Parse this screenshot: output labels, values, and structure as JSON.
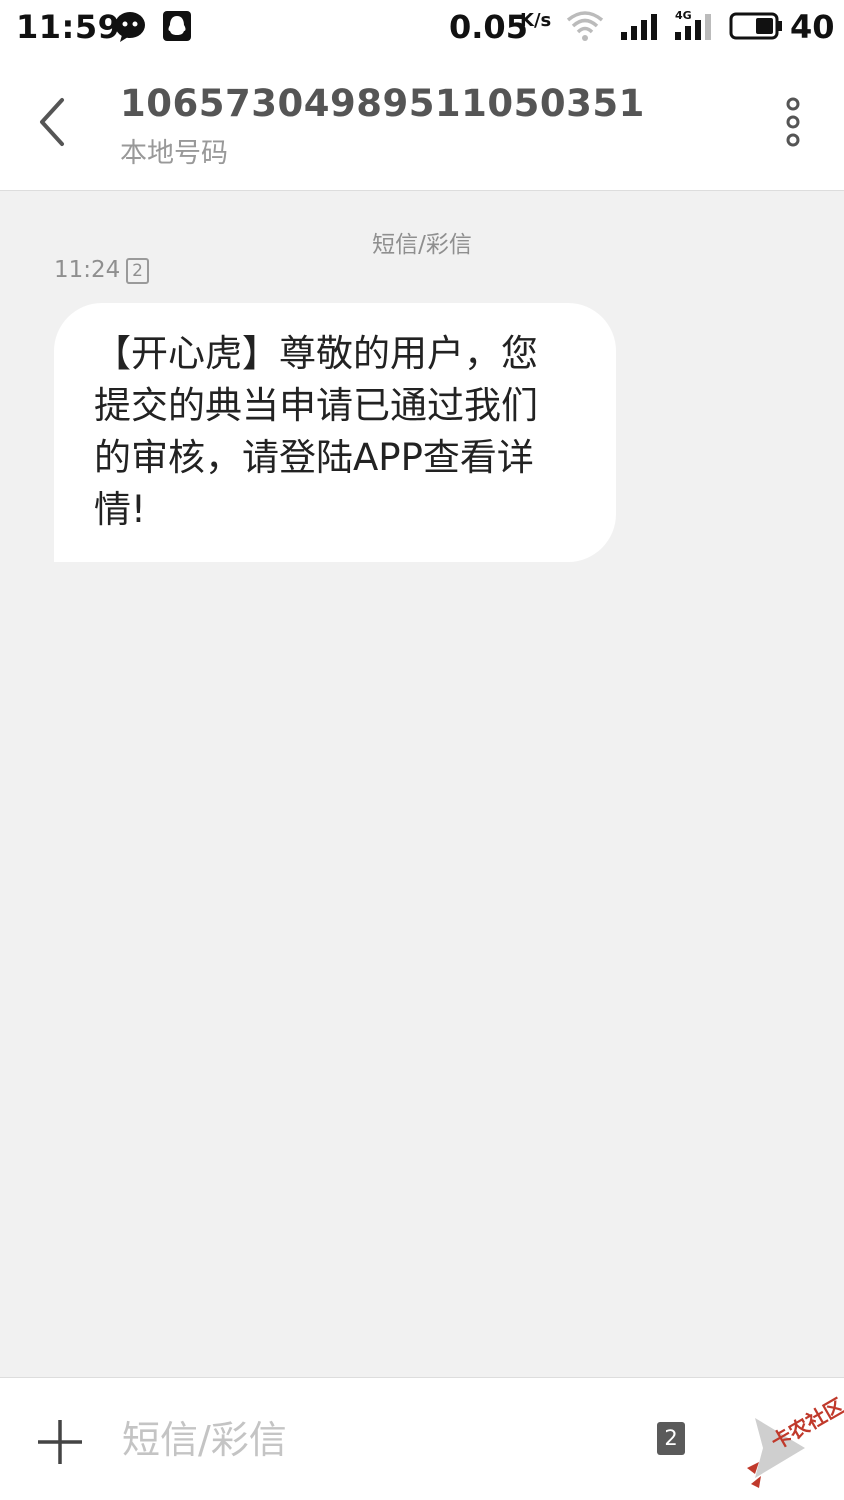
{
  "status_bar": {
    "time": "11:59",
    "net_speed": "0.05",
    "net_speed_unit": "K/s",
    "network_type": "4G",
    "battery": "40"
  },
  "header": {
    "contact_number": "10657304989511050351",
    "contact_subtitle": "本地号码"
  },
  "conversation": {
    "channel_label": "短信/彩信",
    "messages": [
      {
        "time": "11:24",
        "sim": "2",
        "text": "【开心虎】尊敬的用户，您提交的典当申请已通过我们的审核，请登陆APP查看详情!"
      }
    ]
  },
  "composer": {
    "placeholder": "短信/彩信",
    "sim": "2"
  },
  "watermark": "卡农社区",
  "colors": {
    "background": "#f1f1f1",
    "bubble": "#ffffff",
    "secondary_text": "#8f8f8f",
    "watermark": "#c0392b"
  }
}
